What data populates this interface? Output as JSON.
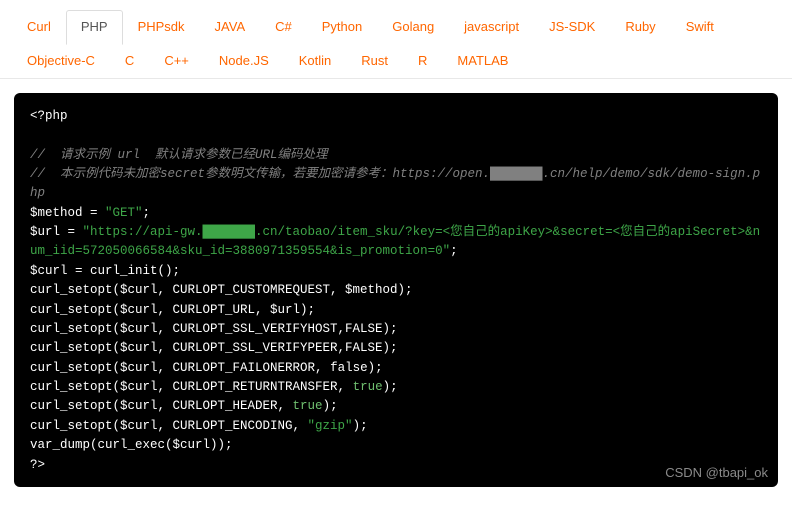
{
  "tabs": {
    "items": [
      {
        "label": "Curl",
        "active": false
      },
      {
        "label": "PHP",
        "active": true
      },
      {
        "label": "PHPsdk",
        "active": false
      },
      {
        "label": "JAVA",
        "active": false
      },
      {
        "label": "C#",
        "active": false
      },
      {
        "label": "Python",
        "active": false
      },
      {
        "label": "Golang",
        "active": false
      },
      {
        "label": "javascript",
        "active": false
      },
      {
        "label": "JS-SDK",
        "active": false
      },
      {
        "label": "Ruby",
        "active": false
      },
      {
        "label": "Swift",
        "active": false
      },
      {
        "label": "Objective-C",
        "active": false
      },
      {
        "label": "C",
        "active": false
      },
      {
        "label": "C++",
        "active": false
      },
      {
        "label": "Node.JS",
        "active": false
      },
      {
        "label": "Kotlin",
        "active": false
      },
      {
        "label": "Rust",
        "active": false
      },
      {
        "label": "R",
        "active": false
      },
      {
        "label": "MATLAB",
        "active": false
      }
    ]
  },
  "code": {
    "open_tag": "<?php",
    "comment1": "//  请求示例 url  默认请求参数已经URL编码处理",
    "comment2": "//  本示例代码未加密secret参数明文传输，若要加密请参考：https://open.███████.cn/help/demo/sdk/demo-sign.php",
    "line_method_a": "$method = ",
    "line_method_b": "\"GET\"",
    "line_method_c": ";",
    "line_url_a": "$url = ",
    "line_url_b": "\"https://api-gw.███████.cn/taobao/item_sku/?key=<您自己的apiKey>&secret=<您自己的apiSecret>&num_iid=572050066584&sku_id=3880971359554&is_promotion=0\"",
    "line_url_c": ";",
    "line_init": "$curl = curl_init();",
    "line_opt1": "curl_setopt($curl, CURLOPT_CUSTOMREQUEST, $method);",
    "line_opt2": "curl_setopt($curl, CURLOPT_URL, $url);",
    "line_opt3": "curl_setopt($curl, CURLOPT_SSL_VERIFYHOST,FALSE);",
    "line_opt4": "curl_setopt($curl, CURLOPT_SSL_VERIFYPEER,FALSE);",
    "line_opt5_a": "curl_setopt($curl, CURLOPT_FAILONERROR, ",
    "line_opt5_b": "false",
    "line_opt5_c": ");",
    "line_opt6_a": "curl_setopt($curl, CURLOPT_RETURNTRANSFER, ",
    "line_opt6_b": "true",
    "line_opt6_c": ");",
    "line_opt7_a": "curl_setopt($curl, CURLOPT_HEADER, ",
    "line_opt7_b": "true",
    "line_opt7_c": ");",
    "line_opt8_a": "curl_setopt($curl, CURLOPT_ENCODING, ",
    "line_opt8_b": "\"gzip\"",
    "line_opt8_c": ");",
    "line_exec": "var_dump(curl_exec($curl));",
    "close_tag": "?>"
  },
  "watermark": "CSDN @tbapi_ok"
}
